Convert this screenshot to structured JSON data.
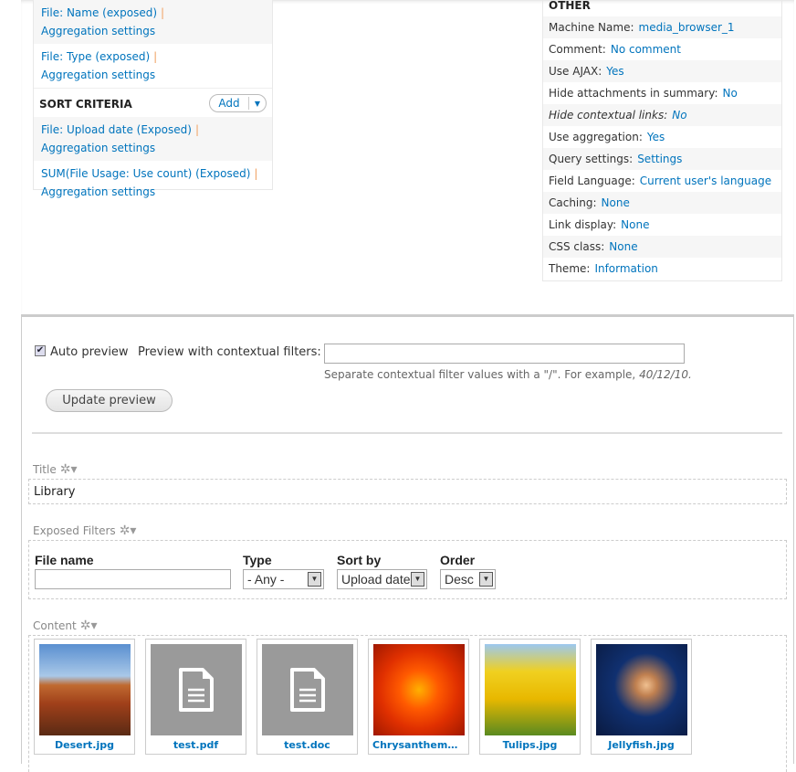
{
  "fields": [
    {
      "label": "File: Name (exposed)",
      "sub": "Aggregation settings"
    },
    {
      "label": "File: Type (exposed)",
      "sub": "Aggregation settings"
    }
  ],
  "sort": {
    "title": "SORT CRITERIA",
    "add_label": "Add",
    "items": [
      {
        "label": "File: Upload date (Exposed)",
        "sub": "Aggregation settings"
      },
      {
        "label": "SUM(File Usage: Use count) (Exposed)",
        "sub": "Aggregation settings"
      }
    ]
  },
  "other": {
    "title": "OTHER",
    "rows": [
      {
        "k": "Machine Name:",
        "v": "media_browser_1"
      },
      {
        "k": "Comment:",
        "v": "No comment"
      },
      {
        "k": "Use AJAX:",
        "v": "Yes"
      },
      {
        "k": "Hide attachments in summary:",
        "v": "No"
      },
      {
        "k": "Hide contextual links:",
        "v": "No",
        "italic": true
      },
      {
        "k": "Use aggregation:",
        "v": "Yes"
      },
      {
        "k": "Query settings:",
        "v": "Settings"
      },
      {
        "k": "Field Language:",
        "v": "Current user's language"
      },
      {
        "k": "Caching:",
        "v": "None"
      },
      {
        "k": "Link display:",
        "v": "None"
      },
      {
        "k": "CSS class:",
        "v": "None"
      },
      {
        "k": "Theme:",
        "v": "Information"
      }
    ]
  },
  "preview": {
    "auto_label": "Auto preview",
    "auto_checked": true,
    "ctx_label": "Preview with contextual filters:",
    "ctx_value": "",
    "help": "Separate contextual filter values with a \"/\". For example, ",
    "help_example": "40/12/10.",
    "button": "Update preview"
  },
  "title_section": {
    "label": "Title",
    "value": "Library"
  },
  "filters": {
    "label": "Exposed Filters",
    "file_name_label": "File name",
    "file_name_value": "",
    "type_label": "Type",
    "type_value": "- Any -",
    "sort_label": "Sort by",
    "sort_value": "Upload date",
    "order_label": "Order",
    "order_value": "Desc"
  },
  "content": {
    "label": "Content",
    "items": [
      {
        "name": "Desert.jpg",
        "kind": "desert"
      },
      {
        "name": "test.pdf",
        "kind": "doc"
      },
      {
        "name": "test.doc",
        "kind": "doc"
      },
      {
        "name": "Chrysanthemum.jpg",
        "kind": "flower"
      },
      {
        "name": "Tulips.jpg",
        "kind": "tulips"
      },
      {
        "name": "Jellyfish.jpg",
        "kind": "jelly"
      }
    ]
  }
}
